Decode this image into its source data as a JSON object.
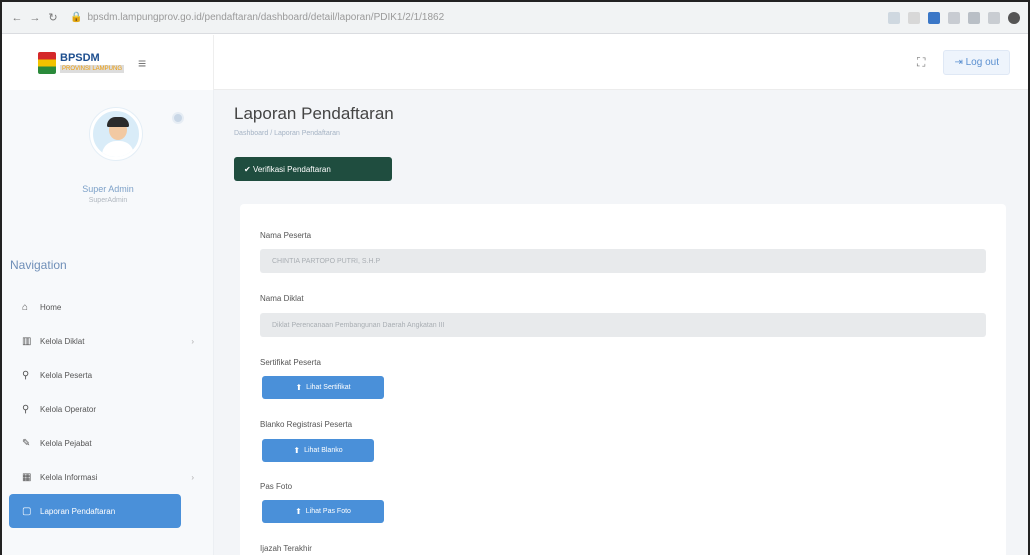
{
  "browser": {
    "url": "bpsdm.lampungprov.go.id/pendaftaran/dashboard/detail/laporan/PDIK1/2/1/1862"
  },
  "brand": {
    "name": "BPSDM",
    "subtitle": "PROVINSI LAMPUNG"
  },
  "topbar": {
    "logout_label": "Log out"
  },
  "profile": {
    "name": "Super Admin",
    "role": "SuperAdmin"
  },
  "sidebar": {
    "nav_title": "Navigation",
    "items": [
      {
        "label": "Home",
        "icon": "home-icon"
      },
      {
        "label": "Kelola Diklat",
        "icon": "building-icon"
      },
      {
        "label": "Kelola Peserta",
        "icon": "person-icon"
      },
      {
        "label": "Kelola Operator",
        "icon": "person-add-icon"
      },
      {
        "label": "Kelola Pejabat",
        "icon": "edit-icon"
      },
      {
        "label": "Kelola Informasi",
        "icon": "calendar-icon"
      },
      {
        "label": "Laporan Pendaftaran",
        "icon": "document-icon"
      }
    ]
  },
  "main": {
    "title": "Laporan Pendaftaran",
    "breadcrumb": "Dashboard / Laporan Pendaftaran",
    "verify_label": "Verifikasi Pendaftaran",
    "fields": {
      "nama_peserta_label": "Nama Peserta",
      "nama_peserta_value": "CHINTIA PARTOPO PUTRI, S.H.P",
      "nama_diklat_label": "Nama Diklat",
      "nama_diklat_value": "Diklat Perencanaan Pembangunan Daerah Angkatan III",
      "sertifikat_label": "Sertifikat Peserta",
      "sertifikat_button": "Lihat Sertifikat",
      "blanko_label": "Blanko Registrasi Peserta",
      "blanko_button": "Lihat Blanko",
      "pasfoto_label": "Pas Foto",
      "pasfoto_button": "Lihat Pas Foto",
      "ijazah_label": "Ijazah Terakhir"
    }
  },
  "colors": {
    "accent": "#4a90d9",
    "verify_button": "#1f4d3f",
    "background": "#f3f5f8"
  }
}
